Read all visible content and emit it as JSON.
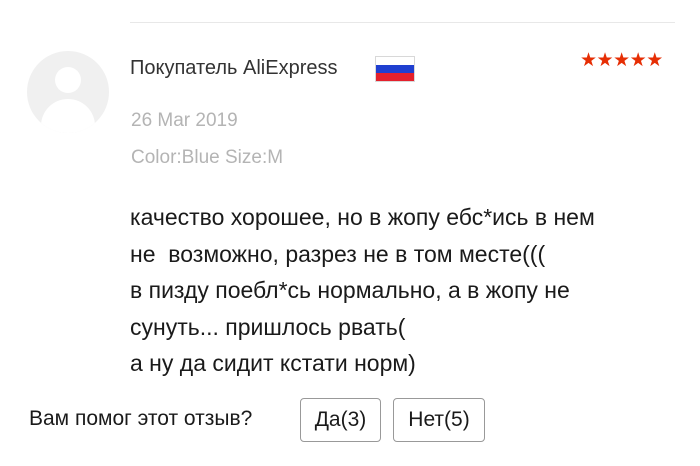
{
  "review": {
    "reviewer": {
      "name": "Покупатель AliExpress",
      "country_flag_icon": "russia-flag-icon",
      "flag_colors": [
        "#ffffff",
        "#1f3fd0",
        "#e4202c"
      ]
    },
    "rating": {
      "value": 5,
      "max": 5,
      "star_color": "#e62e04"
    },
    "date": "26 Mar 2019",
    "variant": "Color:Blue Size:M",
    "text": "качество хорошее, но в жопу ебс*ись в нем\nне  возможно, разрез не в том месте(((\nв пизду поебл*сь нормально, а в жопу не\nсунуть... пришлось рвать(\nа ну да сидит кстати норм)"
  },
  "helpful": {
    "question": "Вам помог этот отзыв?",
    "yes_label": "Да(3)",
    "no_label": "Нет(5)"
  }
}
